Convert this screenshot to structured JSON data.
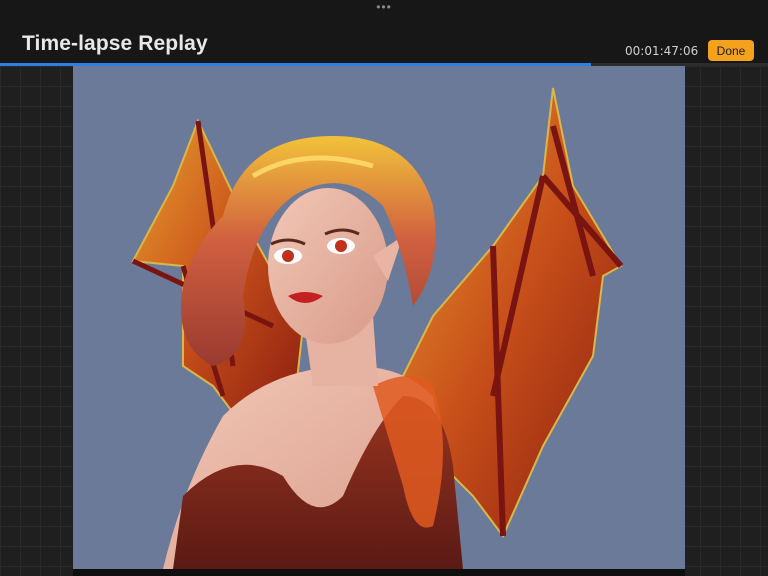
{
  "header": {
    "title": "Time-lapse Replay",
    "elapsed_time": "00:01:47:06",
    "done_label": "Done",
    "more_icon": "ellipsis-icon"
  },
  "playback": {
    "progress_fraction": 0.77,
    "progress_color": "#2f7fe0"
  },
  "artwork": {
    "subject": "red-haired elf woman with dragon wings",
    "background_color": "#6b7a99"
  },
  "colors": {
    "accent": "#f4a21b",
    "toolbar": "#171717"
  }
}
